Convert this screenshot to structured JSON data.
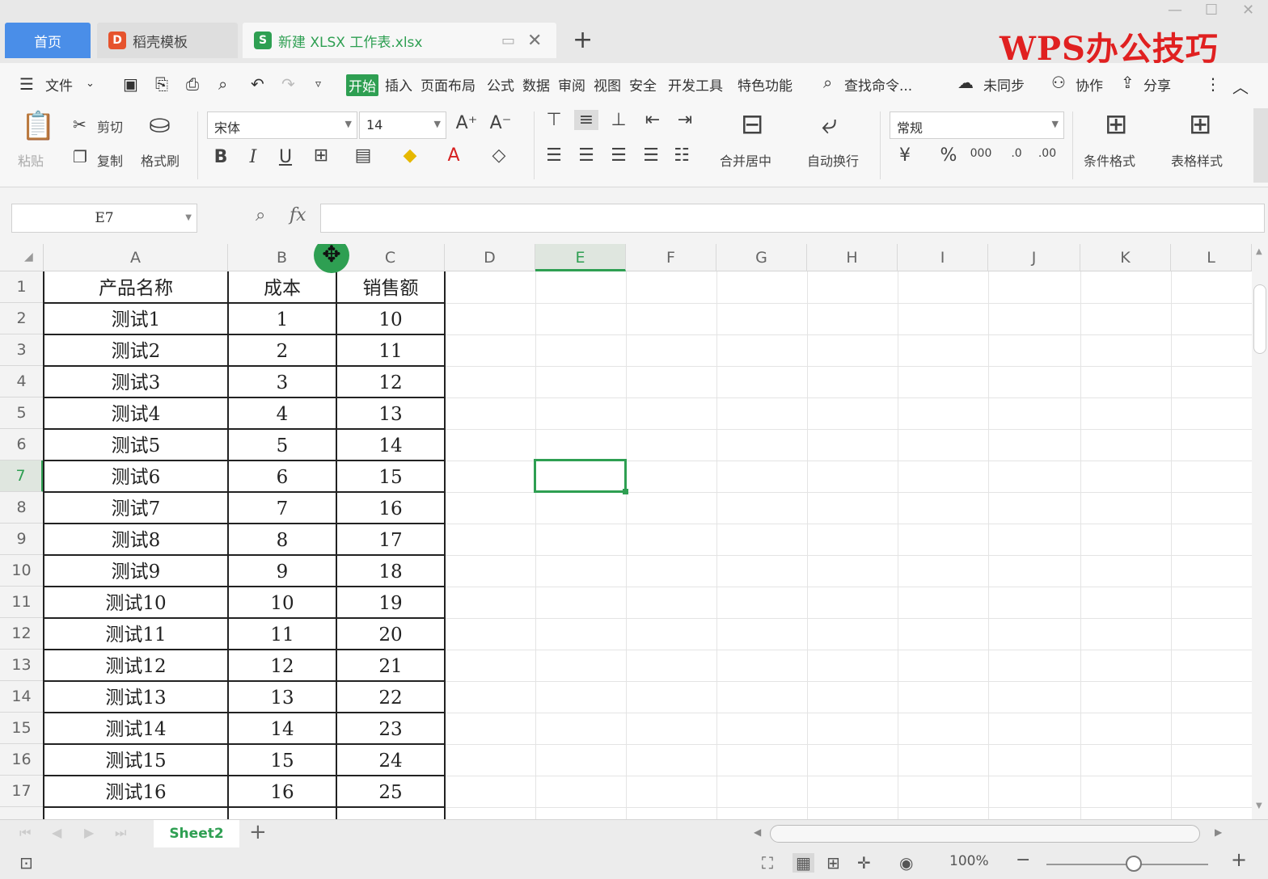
{
  "window": {
    "tabs": [
      {
        "label": "首页",
        "active": false
      },
      {
        "label": "稻壳模板",
        "active": false
      },
      {
        "label": "新建 XLSX 工作表.xlsx",
        "active": true
      }
    ],
    "watermark": "WPS办公技巧"
  },
  "menu": {
    "file": "文件",
    "items": [
      "开始",
      "插入",
      "页面布局",
      "公式",
      "数据",
      "审阅",
      "视图",
      "安全",
      "开发工具",
      "特色功能"
    ],
    "active": "开始",
    "search": "查找命令...",
    "sync": "未同步",
    "collab": "协作",
    "share": "分享"
  },
  "ribbon": {
    "paste": "粘贴",
    "cut": "剪切",
    "copy": "复制",
    "format_painter": "格式刷",
    "font_name": "宋体",
    "font_size": "14",
    "merge_center": "合并居中",
    "wrap_text": "自动换行",
    "number_format": "常规",
    "conditional_format": "条件格式",
    "table_style": "表格样式"
  },
  "formula_bar": {
    "name_box": "E7",
    "fx": "fx",
    "value": ""
  },
  "sheet": {
    "columns": [
      "A",
      "B",
      "C",
      "D",
      "E",
      "F",
      "G",
      "H",
      "I",
      "J",
      "K",
      "L"
    ],
    "selected_column": "E",
    "selected_row": "7",
    "row_numbers": [
      "1",
      "2",
      "3",
      "4",
      "5",
      "6",
      "7",
      "8",
      "9",
      "10",
      "11",
      "12",
      "13",
      "14",
      "15",
      "16",
      "17"
    ],
    "header": [
      "产品名称",
      "成本",
      "销售额"
    ],
    "rows": [
      [
        "测试1",
        "1",
        "10"
      ],
      [
        "测试2",
        "2",
        "11"
      ],
      [
        "测试3",
        "3",
        "12"
      ],
      [
        "测试4",
        "4",
        "13"
      ],
      [
        "测试5",
        "5",
        "14"
      ],
      [
        "测试6",
        "6",
        "15"
      ],
      [
        "测试7",
        "7",
        "16"
      ],
      [
        "测试8",
        "8",
        "17"
      ],
      [
        "测试9",
        "9",
        "18"
      ],
      [
        "测试10",
        "10",
        "19"
      ],
      [
        "测试11",
        "11",
        "20"
      ],
      [
        "测试12",
        "12",
        "21"
      ],
      [
        "测试13",
        "13",
        "22"
      ],
      [
        "测试14",
        "14",
        "23"
      ],
      [
        "测试15",
        "15",
        "24"
      ],
      [
        "测试16",
        "16",
        "25"
      ]
    ]
  },
  "sheet_tabs": {
    "active": "Sheet2"
  },
  "status": {
    "zoom": "100%"
  },
  "colors": {
    "accent": "#2e9f52",
    "home_tab": "#4a8ee8",
    "watermark": "#e02020"
  }
}
